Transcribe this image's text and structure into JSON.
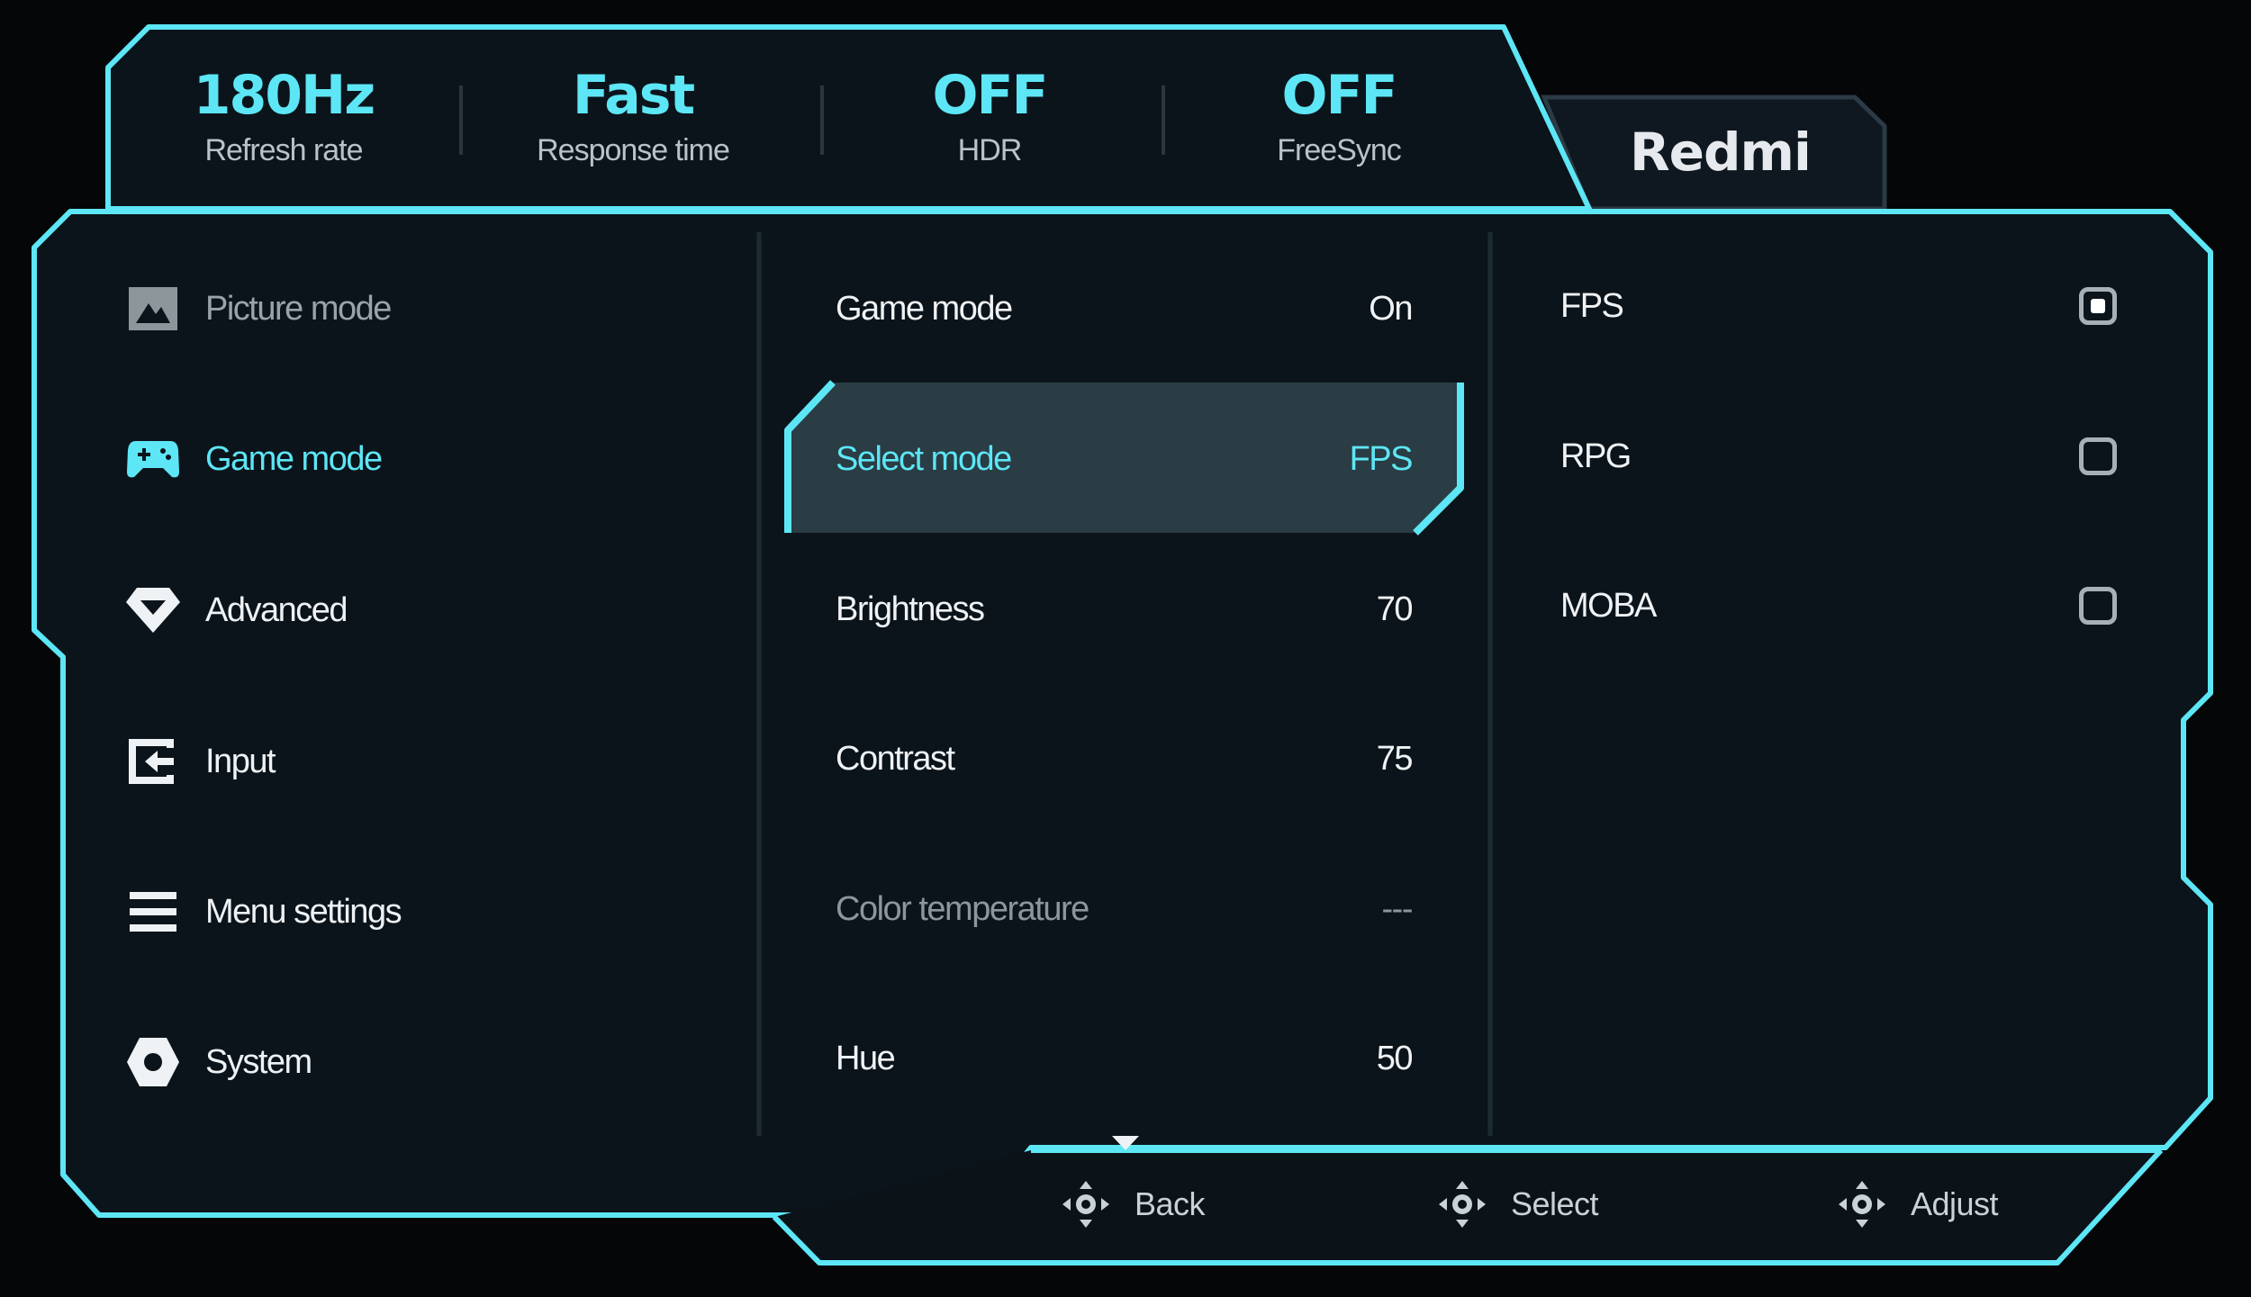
{
  "status_bar": {
    "refresh": {
      "value": "180Hz",
      "label": "Refresh rate"
    },
    "response": {
      "value": "Fast",
      "label": "Response time"
    },
    "hdr": {
      "value": "OFF",
      "label": "HDR"
    },
    "freesync": {
      "value": "OFF",
      "label": "FreeSync"
    }
  },
  "brand": "Redmi",
  "menu": {
    "picture": {
      "label": "Picture mode",
      "icon": "picture-icon"
    },
    "game": {
      "label": "Game mode",
      "icon": "gamepad-icon"
    },
    "advanced": {
      "label": "Advanced",
      "icon": "diamond-icon"
    },
    "input": {
      "label": "Input",
      "icon": "input-icon"
    },
    "menu_settings": {
      "label": "Menu settings",
      "icon": "menu-icon"
    },
    "system": {
      "label": "System",
      "icon": "hexagon-icon"
    }
  },
  "settings": {
    "game_mode": {
      "label": "Game mode",
      "value": "On"
    },
    "select_mode": {
      "label": "Select mode",
      "value": "FPS"
    },
    "brightness": {
      "label": "Brightness",
      "value": "70"
    },
    "contrast": {
      "label": "Contrast",
      "value": "75"
    },
    "color_temperature": {
      "label": "Color temperature",
      "value": "---"
    },
    "hue": {
      "label": "Hue",
      "value": "50"
    }
  },
  "options": {
    "fps": {
      "label": "FPS",
      "selected": true
    },
    "rpg": {
      "label": "RPG",
      "selected": false
    },
    "moba": {
      "label": "MOBA",
      "selected": false
    }
  },
  "footer": {
    "back": "Back",
    "select": "Select",
    "adjust": "Adjust"
  },
  "colors": {
    "accent": "#5de6f5",
    "panel": "#0c141b",
    "highlight": "#2a3c44",
    "background": "#050608"
  }
}
